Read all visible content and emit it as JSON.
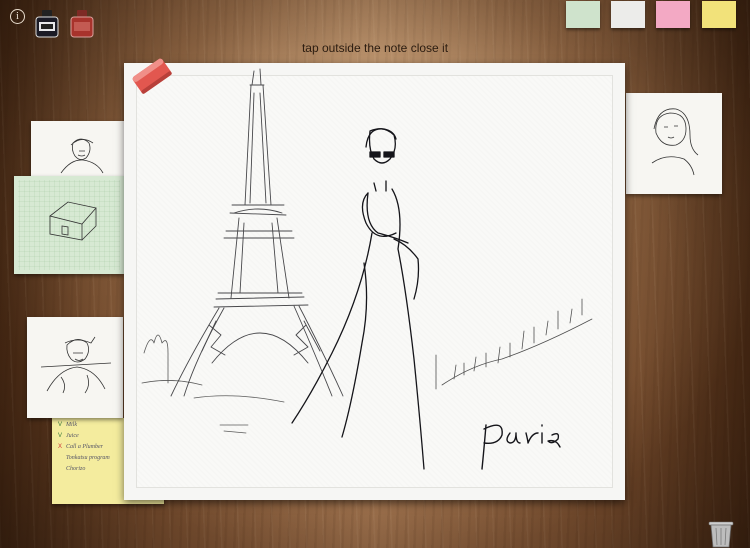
{
  "toolbar": {
    "info_label": "i",
    "ink_colors": {
      "black": "#1a1a22",
      "red": "#a8332c"
    },
    "note_swatches": [
      "#cfe3cc",
      "#ececea",
      "#f3a9c4",
      "#f2e27a"
    ]
  },
  "hint_text": "tap outside the note close it",
  "yellow_note": {
    "lines": [
      "Milk",
      "Juice",
      "Call a Plumber",
      "Tonkatsu program",
      "Chorizo"
    ],
    "marks": [
      "V",
      "V",
      "X",
      "",
      ""
    ]
  },
  "main_note": {
    "signature": "Paris"
  },
  "icons": {
    "eraser": "eraser-icon",
    "trash": "trash-icon"
  }
}
